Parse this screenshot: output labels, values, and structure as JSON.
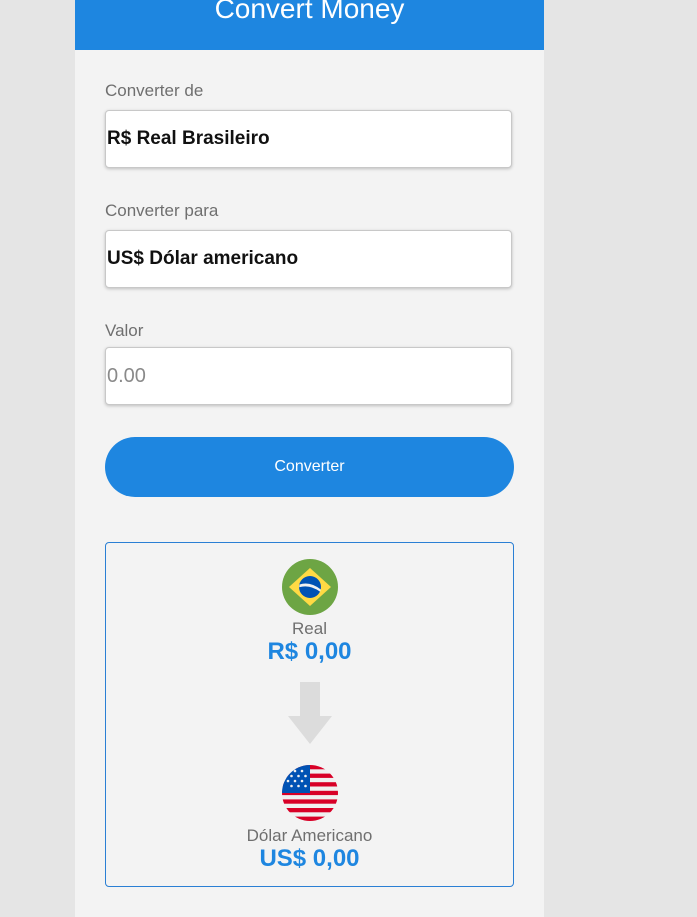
{
  "header": {
    "title": "Convert Money",
    "color": "#1e86e0"
  },
  "form": {
    "from_label": "Converter de",
    "from_value": "R$ Real Brasileiro",
    "to_label": "Converter para",
    "to_value": "US$ Dólar americano",
    "amount_label": "Valor",
    "amount_placeholder": "0.00",
    "convert_label": "Converter"
  },
  "result": {
    "from_icon": "brazil-flag-icon",
    "from_name": "Real",
    "from_value": "R$ 0,00",
    "direction_icon": "arrow-down-icon",
    "to_icon": "usa-flag-icon",
    "to_name": "Dólar Americano",
    "to_value": "US$ 0,00",
    "accent_color": "#1e86e0"
  }
}
